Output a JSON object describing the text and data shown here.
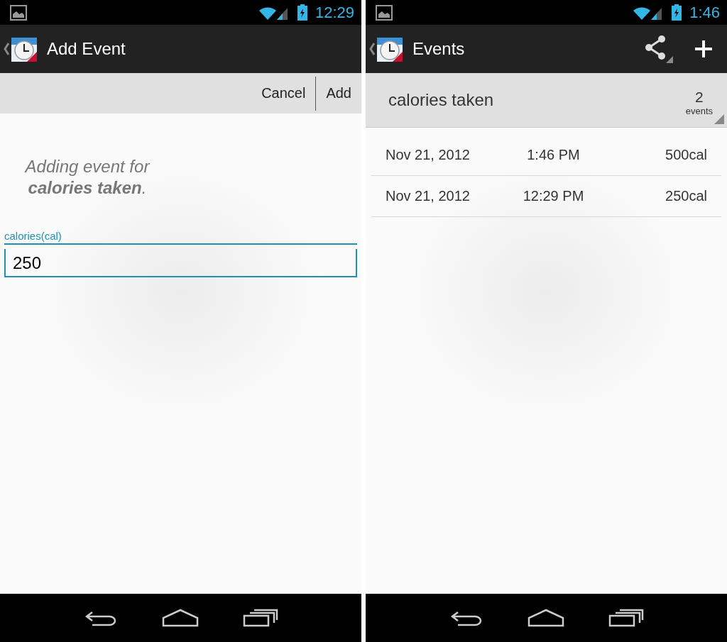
{
  "screens": [
    {
      "kind": "add_event",
      "status_bar": {
        "time": "12:29"
      },
      "action_bar": {
        "title": "Add Event"
      },
      "buttons": [
        "Cancel",
        "Add"
      ],
      "message": "Adding event for **calories taken**.",
      "field": {
        "label": "calories(cal)",
        "value": "250"
      }
    },
    {
      "kind": "events",
      "status_bar": {
        "time": "1:46"
      },
      "action_bar": {
        "title": "Events"
      },
      "header": {
        "name": "calories taken",
        "count": "2",
        "count_label": "events"
      },
      "rows": [
        {
          "date": "Nov 21, 2012",
          "time": "1:46 PM",
          "amount": "500cal"
        },
        {
          "date": "Nov 21, 2012",
          "time": "12:29 PM",
          "amount": "250cal"
        }
      ]
    }
  ]
}
